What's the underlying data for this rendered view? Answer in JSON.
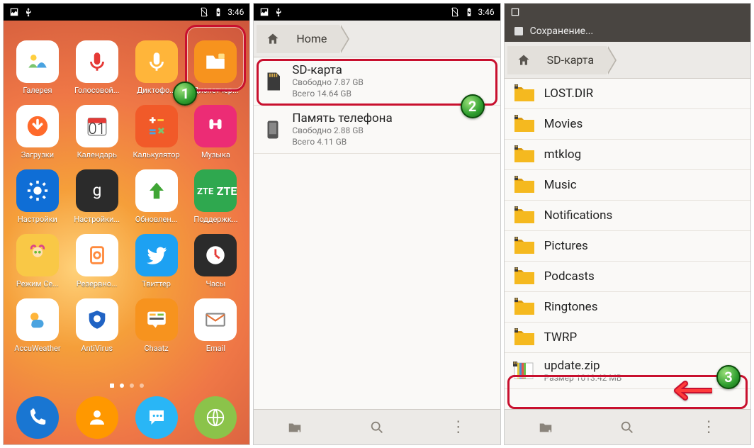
{
  "status": {
    "time": "3:46",
    "icons_left": [
      "image-icon",
      "usb-icon"
    ],
    "icons_right": [
      "no-sim-icon",
      "battery-charging-icon"
    ]
  },
  "panel1": {
    "apps": [
      {
        "name": "gallery",
        "label": "Галерея",
        "bg": "#ffffff",
        "svg": "gallery"
      },
      {
        "name": "voice",
        "label": "Голосовой...",
        "bg": "#ffffff",
        "svg": "mic-red"
      },
      {
        "name": "recorder",
        "label": "Диктофо...",
        "bg": "#ffb53a",
        "svg": "mic-white"
      },
      {
        "name": "file-manager",
        "label": "Диспетчер...",
        "bg": "#f7931e",
        "svg": "folder-app"
      },
      {
        "name": "downloads",
        "label": "Загрузки",
        "bg": "#ffffff",
        "svg": "download"
      },
      {
        "name": "calendar",
        "label": "Календарь",
        "bg": "#ffffff",
        "svg": "cal",
        "text": "01"
      },
      {
        "name": "calculator",
        "label": "Калькулятор",
        "bg": "#f15a29",
        "svg": "calc"
      },
      {
        "name": "music",
        "label": "Музыка",
        "bg": "#ec2c75",
        "svg": "music"
      },
      {
        "name": "settings",
        "label": "Настройки",
        "bg": "#0f6ed6",
        "svg": "gear"
      },
      {
        "name": "google-settings",
        "label": "Настройки...",
        "bg": "#2b2b2b",
        "svg": "g"
      },
      {
        "name": "update",
        "label": "Обновлен...",
        "bg": "#ffffff",
        "svg": "up-green"
      },
      {
        "name": "support",
        "label": "Поддержк...",
        "bg": "#2fa84f",
        "svg": "zte",
        "text": "ZTE"
      },
      {
        "name": "kids-mode",
        "label": "Режим Се...",
        "bg": "#f9c846",
        "svg": "kids"
      },
      {
        "name": "backup",
        "label": "Резервно...",
        "bg": "#ffffff",
        "svg": "backup"
      },
      {
        "name": "twitter",
        "label": "Твиттер",
        "bg": "#1da1f2",
        "svg": "twitter"
      },
      {
        "name": "clock",
        "label": "Часы",
        "bg": "#2b2b2b",
        "svg": "clock"
      },
      {
        "name": "weather",
        "label": "AccuWeather",
        "bg": "#ffffff",
        "svg": "weather"
      },
      {
        "name": "antivirus",
        "label": "AntiVirus",
        "bg": "#ffffff",
        "svg": "shield"
      },
      {
        "name": "chaatz",
        "label": "Chaatz",
        "bg": "#f7931e",
        "svg": "chaatz"
      },
      {
        "name": "email",
        "label": "Email",
        "bg": "#ffffff",
        "svg": "mail"
      }
    ],
    "dock": [
      {
        "name": "phone",
        "bg": "#1976d2",
        "svg": "phone"
      },
      {
        "name": "contacts",
        "bg": "#ff9800",
        "svg": "person"
      },
      {
        "name": "messages",
        "bg": "#29b6f6",
        "svg": "msg"
      },
      {
        "name": "browser",
        "bg": "#8bc34a",
        "svg": "globe"
      }
    ],
    "highlight_app_index": 3,
    "badge": "1"
  },
  "panel2": {
    "breadcrumb": [
      {
        "text": "Home"
      }
    ],
    "storages": [
      {
        "name": "sd-card",
        "title": "SD-карта",
        "free": "Свободно 7.87 GB",
        "total": "Всего 14.64 GB",
        "icon": "sd"
      },
      {
        "name": "phone-mem",
        "title": "Память телефона",
        "free": "Свободно 2.88 GB",
        "total": "Всего 4.11 GB",
        "icon": "phone-store"
      }
    ],
    "highlight_index": 0,
    "badge": "2"
  },
  "panel3": {
    "header_title": "Сохранение...",
    "breadcrumb": [
      {
        "text": "SD-карта"
      }
    ],
    "folders": [
      "LOST.DIR",
      "Movies",
      "mtklog",
      "Music",
      "Notifications",
      "Pictures",
      "Podcasts",
      "Ringtones",
      "TWRP"
    ],
    "file": {
      "name": "update.zip",
      "size": "Размер 1013.42 MB"
    },
    "badge": "3"
  }
}
